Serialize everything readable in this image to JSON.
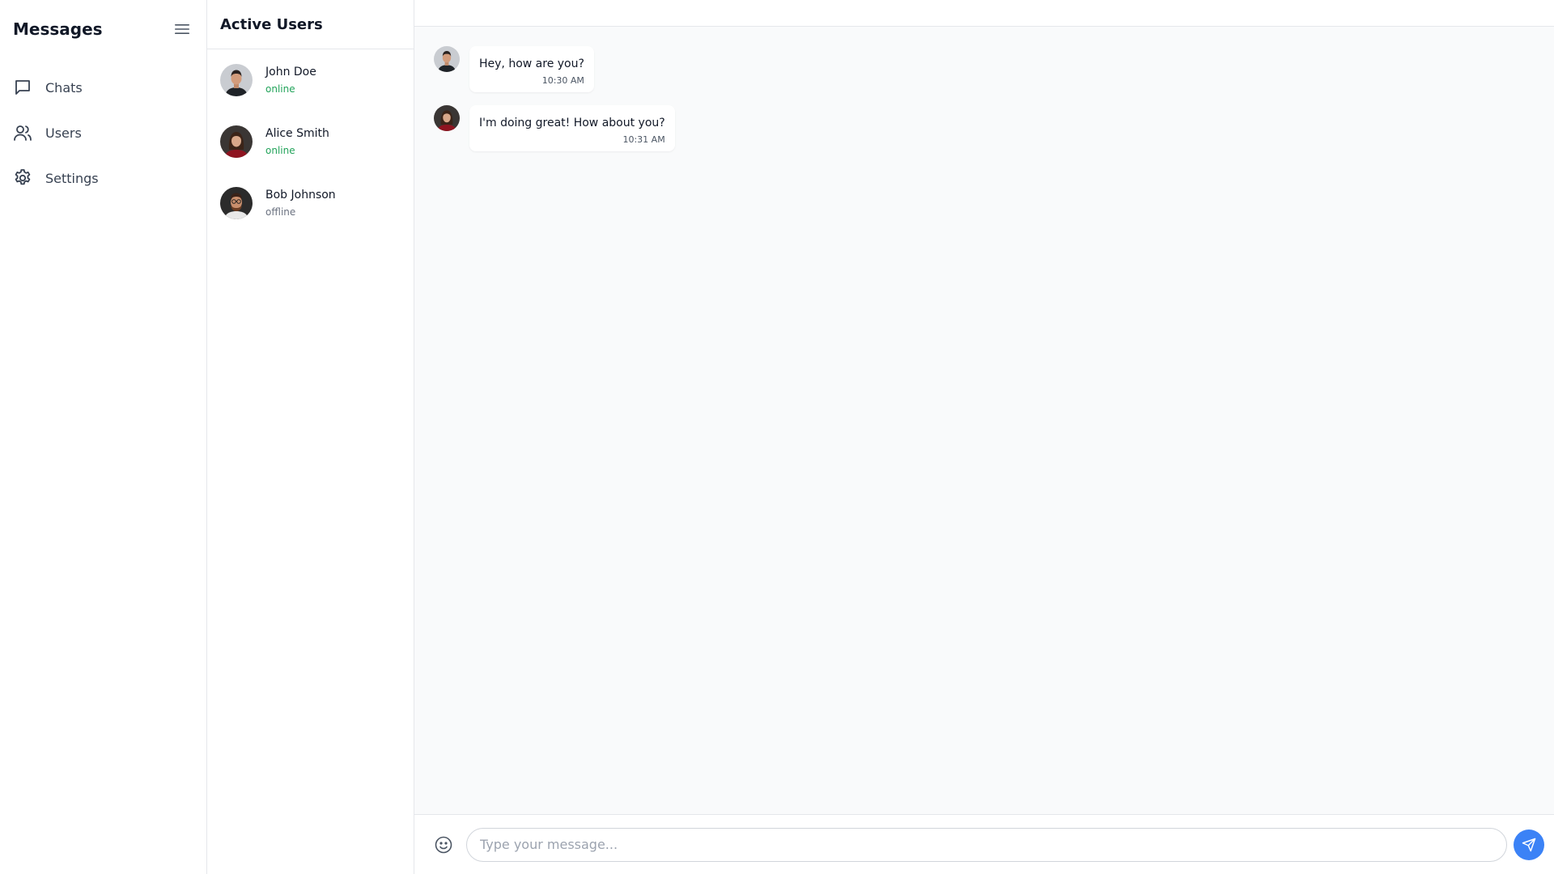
{
  "sidebar": {
    "title": "Messages",
    "menu_icon": "hamburger-menu-icon",
    "items": [
      {
        "label": "Chats",
        "icon": "chat-bubble-icon"
      },
      {
        "label": "Users",
        "icon": "users-icon"
      },
      {
        "label": "Settings",
        "icon": "gear-icon"
      }
    ]
  },
  "users_panel": {
    "title": "Active Users",
    "users": [
      {
        "name": "John Doe",
        "status": "online"
      },
      {
        "name": "Alice Smith",
        "status": "online"
      },
      {
        "name": "Bob Johnson",
        "status": "offline"
      }
    ]
  },
  "chat": {
    "messages": [
      {
        "text": "Hey, how are you?",
        "time": "10:30 AM",
        "sender": "John Doe"
      },
      {
        "text": "I'm doing great! How about you?",
        "time": "10:31 AM",
        "sender": "Alice Smith"
      }
    ],
    "composer": {
      "placeholder": "Type your message...",
      "value": "",
      "emoji_icon": "smiley-icon",
      "send_icon": "send-icon"
    }
  },
  "colors": {
    "online": "#22a35a",
    "offline": "#6b7280",
    "accent": "#3b82f6"
  }
}
